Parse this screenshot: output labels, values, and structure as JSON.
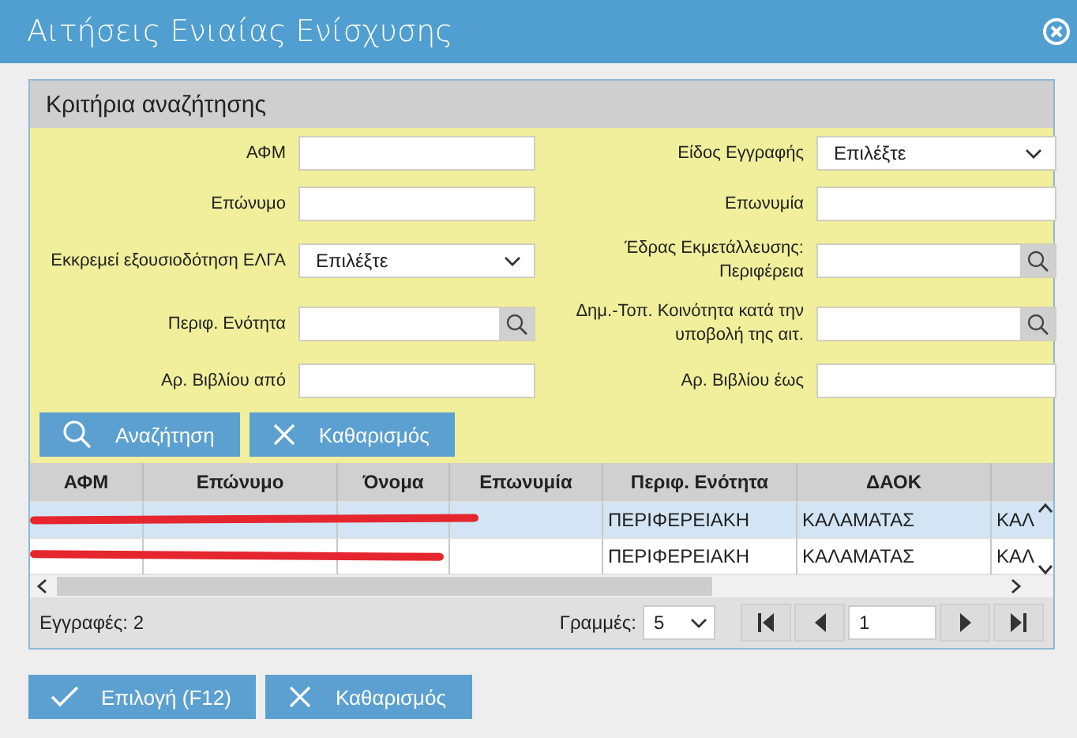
{
  "window": {
    "title": "Αιτήσεις Ενιαίας Ενίσχυσης"
  },
  "criteria": {
    "title": "Κριτήρια αναζήτησης",
    "fields": [
      {
        "label": "ΑΦΜ",
        "kind": "text"
      },
      {
        "label": "Είδος Εγγραφής",
        "kind": "select",
        "value": "Επιλέξτε"
      },
      {
        "label": "Επώνυμο",
        "kind": "text"
      },
      {
        "label": "Επωνυμία",
        "kind": "text"
      },
      {
        "label": "Εκκρεμεί εξουσιοδότηση ΕΛΓΑ",
        "kind": "select",
        "value": "Επιλέξτε"
      },
      {
        "label": "Έδρας Εκμετάλλευσης: Περιφέρεια",
        "kind": "lookup"
      },
      {
        "label": "Περιφ. Ενότητα",
        "kind": "lookup"
      },
      {
        "label": "Δημ.-Τοπ. Κοινότητα κατά την υποβολή της αιτ.",
        "kind": "lookup"
      },
      {
        "label": "Αρ. Βιβλίου από",
        "kind": "text"
      },
      {
        "label": "Αρ. Βιβλίου έως",
        "kind": "text"
      }
    ],
    "buttons": [
      {
        "label": "Αναζήτηση",
        "kind": "search"
      },
      {
        "label": "Καθαρισμός",
        "kind": "clear"
      }
    ]
  },
  "table": {
    "columns": [
      "ΑΦΜ",
      "Επώνυμο",
      "Όνομα",
      "Επωνυμία",
      "Περιφ. Ενότητα",
      "ΔΑΟΚ"
    ],
    "rows": [
      {
        "selected": true,
        "redacted": true,
        "cells": [
          null,
          null,
          null,
          null,
          "ΠΕΡΙΦΕΡΕΙΑΚΗ",
          "ΚΑΛΑΜΑΤΑΣ",
          "ΚΑΛ"
        ]
      },
      {
        "selected": false,
        "redacted": true,
        "cells": [
          null,
          null,
          null,
          null,
          "ΠΕΡΙΦΕΡΕΙΑΚΗ",
          "ΚΑΛΑΜΑΤΑΣ",
          "ΚΑΛ"
        ]
      }
    ]
  },
  "pager": {
    "records": "Εγγραφές: 2",
    "rows_label": "Γραμμές:",
    "rows_value": "5",
    "page": "1"
  },
  "buttons": [
    {
      "label": "Επιλογή (F12)",
      "kind": "check"
    },
    {
      "label": "Καθαρισμός",
      "kind": "clear"
    }
  ]
}
